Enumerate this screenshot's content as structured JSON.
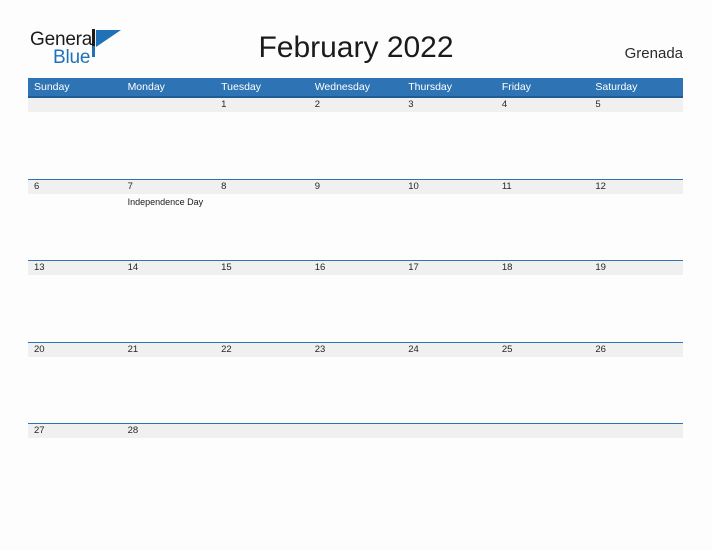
{
  "brand": {
    "name_part1": "General",
    "name_part2": "Blue",
    "logo_icon": "blue-flag-triangle-icon",
    "color_dark": "#1b1b1b",
    "color_blue": "#2072b8"
  },
  "header": {
    "title": "February 2022",
    "country": "Grenada",
    "month": "February",
    "year": "2022"
  },
  "theme": {
    "header_blue": "#2e74b5",
    "header_blue_dark": "#1f5c94",
    "row_band_gray": "#f0f0f0",
    "page_background": "#fdfdfd",
    "text_color": "#262626"
  },
  "weekdays": [
    {
      "label": "Sunday"
    },
    {
      "label": "Monday"
    },
    {
      "label": "Tuesday"
    },
    {
      "label": "Wednesday"
    },
    {
      "label": "Thursday"
    },
    {
      "label": "Friday"
    },
    {
      "label": "Saturday"
    }
  ],
  "weeks": [
    {
      "days": [
        {
          "num": "",
          "event": ""
        },
        {
          "num": "",
          "event": ""
        },
        {
          "num": "1",
          "event": ""
        },
        {
          "num": "2",
          "event": ""
        },
        {
          "num": "3",
          "event": ""
        },
        {
          "num": "4",
          "event": ""
        },
        {
          "num": "5",
          "event": ""
        }
      ]
    },
    {
      "days": [
        {
          "num": "6",
          "event": ""
        },
        {
          "num": "7",
          "event": "Independence Day"
        },
        {
          "num": "8",
          "event": ""
        },
        {
          "num": "9",
          "event": ""
        },
        {
          "num": "10",
          "event": ""
        },
        {
          "num": "11",
          "event": ""
        },
        {
          "num": "12",
          "event": ""
        }
      ]
    },
    {
      "days": [
        {
          "num": "13",
          "event": ""
        },
        {
          "num": "14",
          "event": ""
        },
        {
          "num": "15",
          "event": ""
        },
        {
          "num": "16",
          "event": ""
        },
        {
          "num": "17",
          "event": ""
        },
        {
          "num": "18",
          "event": ""
        },
        {
          "num": "19",
          "event": ""
        }
      ]
    },
    {
      "days": [
        {
          "num": "20",
          "event": ""
        },
        {
          "num": "21",
          "event": ""
        },
        {
          "num": "22",
          "event": ""
        },
        {
          "num": "23",
          "event": ""
        },
        {
          "num": "24",
          "event": ""
        },
        {
          "num": "25",
          "event": ""
        },
        {
          "num": "26",
          "event": ""
        }
      ]
    },
    {
      "days": [
        {
          "num": "27",
          "event": ""
        },
        {
          "num": "28",
          "event": ""
        },
        {
          "num": "",
          "event": ""
        },
        {
          "num": "",
          "event": ""
        },
        {
          "num": "",
          "event": ""
        },
        {
          "num": "",
          "event": ""
        },
        {
          "num": "",
          "event": ""
        }
      ]
    }
  ]
}
